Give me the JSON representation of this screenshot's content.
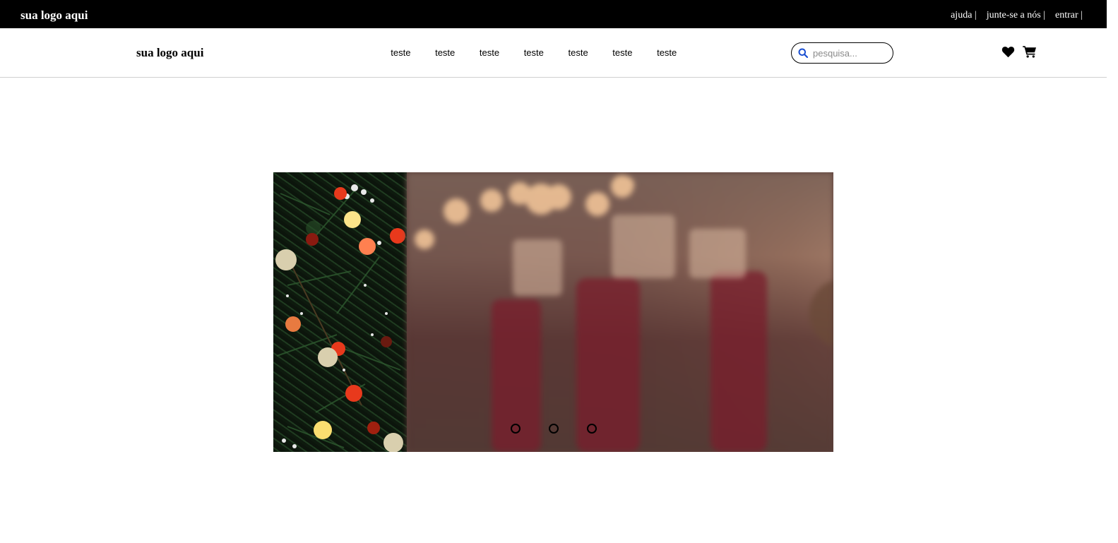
{
  "topbar": {
    "logo": "sua logo aqui",
    "links": [
      "ajuda",
      "junte-se a nós",
      "entrar"
    ]
  },
  "navbar": {
    "logo": "sua logo aqui",
    "menu": [
      "teste",
      "teste",
      "teste",
      "teste",
      "teste",
      "teste",
      "teste"
    ],
    "search": {
      "placeholder": "pesquisa...",
      "icon": "search-icon"
    },
    "icons": [
      "heart-icon",
      "cart-icon"
    ]
  },
  "slider": {
    "slide_count": 3,
    "active_slide": 1
  },
  "colors": {
    "topbar_bg": "#000000",
    "search_icon": "#1a4fd1"
  }
}
